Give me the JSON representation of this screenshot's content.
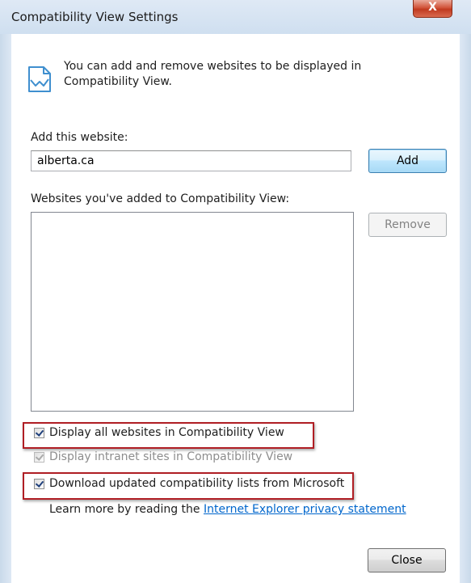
{
  "window": {
    "title": "Compatibility View Settings",
    "close_glyph": "X"
  },
  "intro": {
    "icon": "compatibility-view-icon",
    "text": "You can add and remove websites to be displayed in Compatibility View."
  },
  "add_website": {
    "label": "Add this website:",
    "value": "alberta.ca",
    "add_button": "Add"
  },
  "websites_list": {
    "label": "Websites you've added to Compatibility View:",
    "items": [],
    "remove_button": "Remove"
  },
  "options": [
    {
      "label": "Display all websites in Compatibility View",
      "checked": true,
      "enabled": true,
      "highlighted": true
    },
    {
      "label": "Display intranet sites in Compatibility View",
      "checked": true,
      "enabled": false,
      "highlighted": false
    },
    {
      "label": "Download updated compatibility lists from Microsoft",
      "checked": true,
      "enabled": true,
      "highlighted": true
    }
  ],
  "learn_more": {
    "prefix": "Learn more by reading the ",
    "link_text": "Internet Explorer privacy statement"
  },
  "close_button": "Close",
  "colors": {
    "highlight_border": "#b01e24",
    "link": "#0066cc",
    "title_bar": "#dfe9f5"
  }
}
